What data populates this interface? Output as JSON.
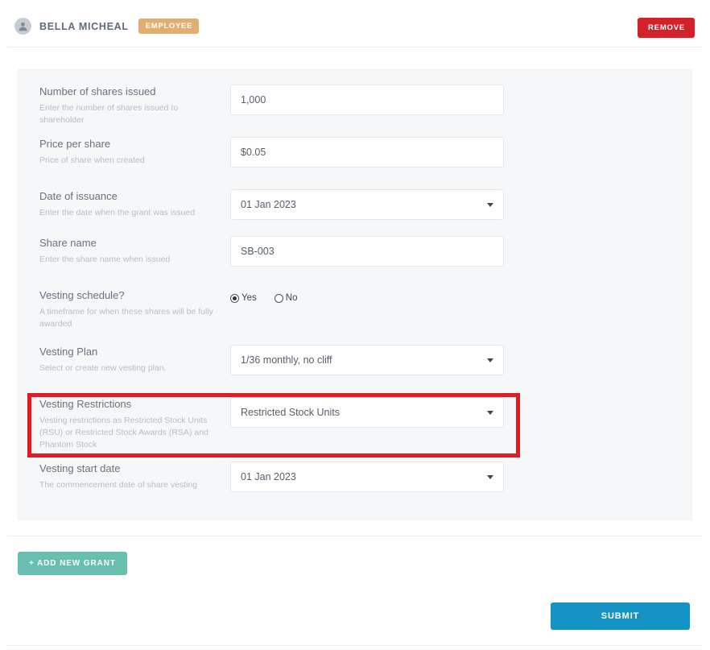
{
  "header": {
    "avatar_icon": "user-avatar-icon",
    "member_name": "BELLA MICHEAL",
    "role_badge": "EMPLOYEE",
    "remove_label": "REMOVE"
  },
  "form": {
    "fields": [
      {
        "key": "shares_issued",
        "label": "Number of shares issued",
        "hint": "Enter the number of shares issued to shareholder",
        "control": "text",
        "value": "1,000"
      },
      {
        "key": "price_per_share",
        "label": "Price per share",
        "hint": "Price of share when created",
        "control": "text",
        "value": "$0.05"
      },
      {
        "key": "date_of_issuance",
        "label": "Date of issuance",
        "hint": "Enter the date when the grant was issued",
        "control": "select",
        "value": "01 Jan 2023"
      },
      {
        "key": "share_name",
        "label": "Share name",
        "hint": "Enter the share name when issued",
        "control": "text",
        "value": "SB-003"
      },
      {
        "key": "vesting_schedule",
        "label": "Vesting schedule?",
        "hint": "A timeframe for when these shares will be fully awarded",
        "control": "radio",
        "options": [
          "Yes",
          "No"
        ],
        "value": "Yes"
      },
      {
        "key": "vesting_plan",
        "label": "Vesting Plan",
        "hint": "Select or create new vesting plan.",
        "control": "select",
        "value": "1/36 monthly, no cliff"
      },
      {
        "key": "vesting_restrictions",
        "label": "Vesting Restrictions",
        "hint": "Vesting restrictions as Restricted Stock Units (RSU) or Restricted Stock Awards (RSA) and Phantom Stock",
        "control": "select",
        "value": "Restricted Stock Units",
        "highlighted": true
      },
      {
        "key": "vesting_start_date",
        "label": "Vesting start date",
        "hint": "The commencement date of share vesting",
        "control": "select",
        "value": "01 Jan 2023"
      }
    ]
  },
  "footer": {
    "add_grant_label": "+ ADD NEW GRANT",
    "submit_label": "SUBMIT"
  },
  "colors": {
    "remove_red": "#d32029",
    "badge_orange": "#e3ae6d",
    "add_grant_teal": "#68bfb0",
    "submit_blue": "#1593c4",
    "highlight_red": "#e01b22",
    "panel_bg": "#f6f7f8"
  }
}
